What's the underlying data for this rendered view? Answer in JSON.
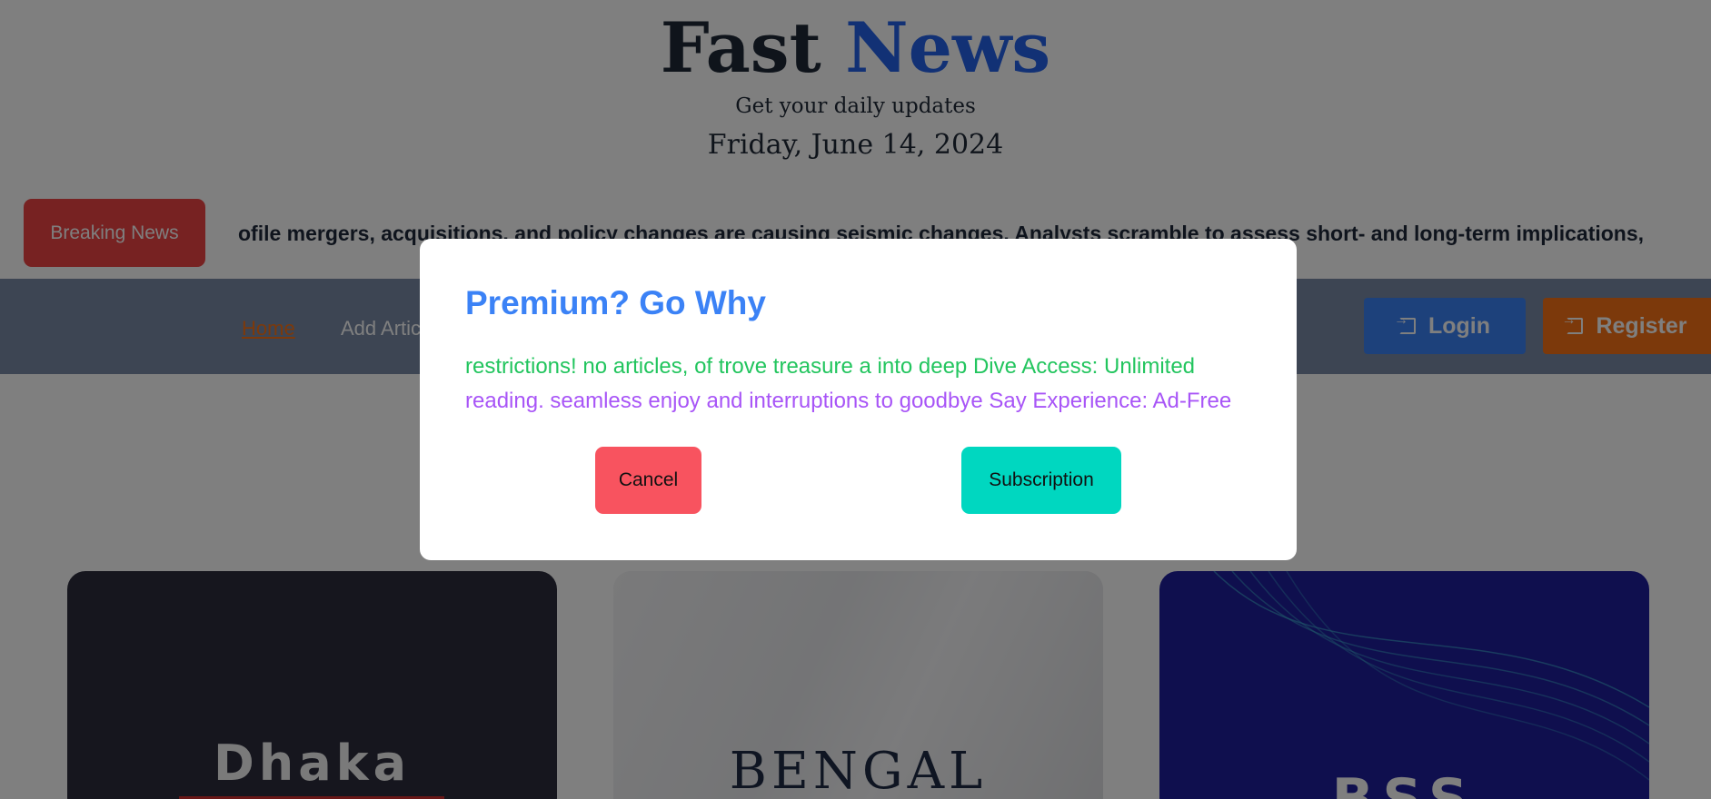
{
  "header": {
    "title_main": "Fast",
    "title_accent": "News",
    "tagline": "Get your daily updates",
    "date": "Friday, June 14, 2024"
  },
  "breaking": {
    "badge": "Breaking News",
    "ticker": "ofile mergers, acquisitions, and policy changes are causing seismic changes. Analysts scramble to assess short- and long-term implications,"
  },
  "nav": {
    "home": "Home",
    "add_article": "Add Artic",
    "login": "Login",
    "register": "Register"
  },
  "cards": [
    {
      "label": "Dhaka"
    },
    {
      "label": "BENGAL"
    },
    {
      "label": "BSS"
    }
  ],
  "modal": {
    "title": "Premium? Go Why",
    "line1": "restrictions! no articles, of trove treasure a into deep Dive Access: Unlimited",
    "line2": "reading. seamless enjoy and interruptions to goodbye Say Experience: Ad-Free",
    "cancel": "Cancel",
    "subscription": "Subscription"
  },
  "colors": {
    "accent_blue": "#2563eb",
    "breaking_red": "#ef4444",
    "nav_bg": "#7b8ba7",
    "login_blue": "#3b82f6",
    "register_orange": "#f97316",
    "modal_title": "#3b82f6",
    "modal_line1": "#22c55e",
    "modal_line2": "#a855f7",
    "cancel_bg": "#f8535f",
    "subscription_bg": "#00d7c0"
  }
}
